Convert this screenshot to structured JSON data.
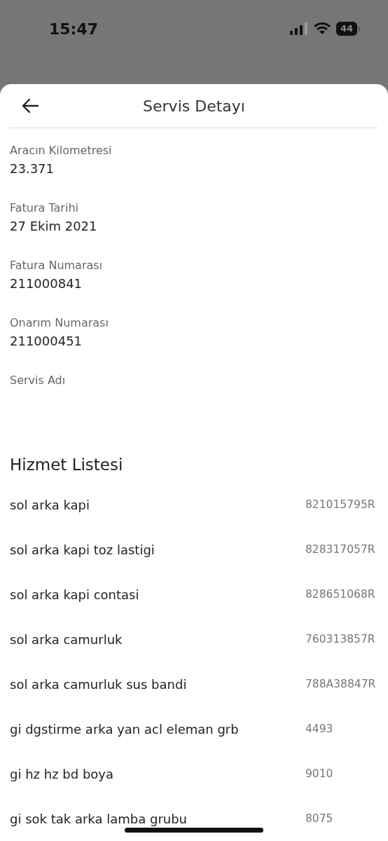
{
  "status_bar": {
    "time": "15:47",
    "battery": "44"
  },
  "sheet": {
    "title": "Servis Detayı"
  },
  "fields": [
    {
      "label": "Aracın Kilometresi",
      "value": "23.371"
    },
    {
      "label": "Fatura Tarihi",
      "value": "27 Ekim 2021"
    },
    {
      "label": "Fatura Numarası",
      "value": "211000841"
    },
    {
      "label": "Onarım Numarası",
      "value": "211000451"
    },
    {
      "label": "Servis Adı"
    }
  ],
  "service_list": {
    "title": "Hizmet Listesi",
    "rows": [
      {
        "name": "sol arka kapi",
        "code": "821015795R"
      },
      {
        "name": "sol arka kapi toz lastigi",
        "code": "828317057R"
      },
      {
        "name": "sol arka kapi contasi",
        "code": "828651068R"
      },
      {
        "name": "sol arka camurluk",
        "code": "760313857R"
      },
      {
        "name": "sol arka camurluk sus bandi",
        "code": "788A38847R"
      },
      {
        "name": "gi dgstirme arka yan acl eleman grb",
        "code": "4493"
      },
      {
        "name": "gi hz hz bd boya",
        "code": "9010"
      },
      {
        "name": "gi sok tak arka lamba grubu",
        "code": "8075"
      }
    ]
  }
}
